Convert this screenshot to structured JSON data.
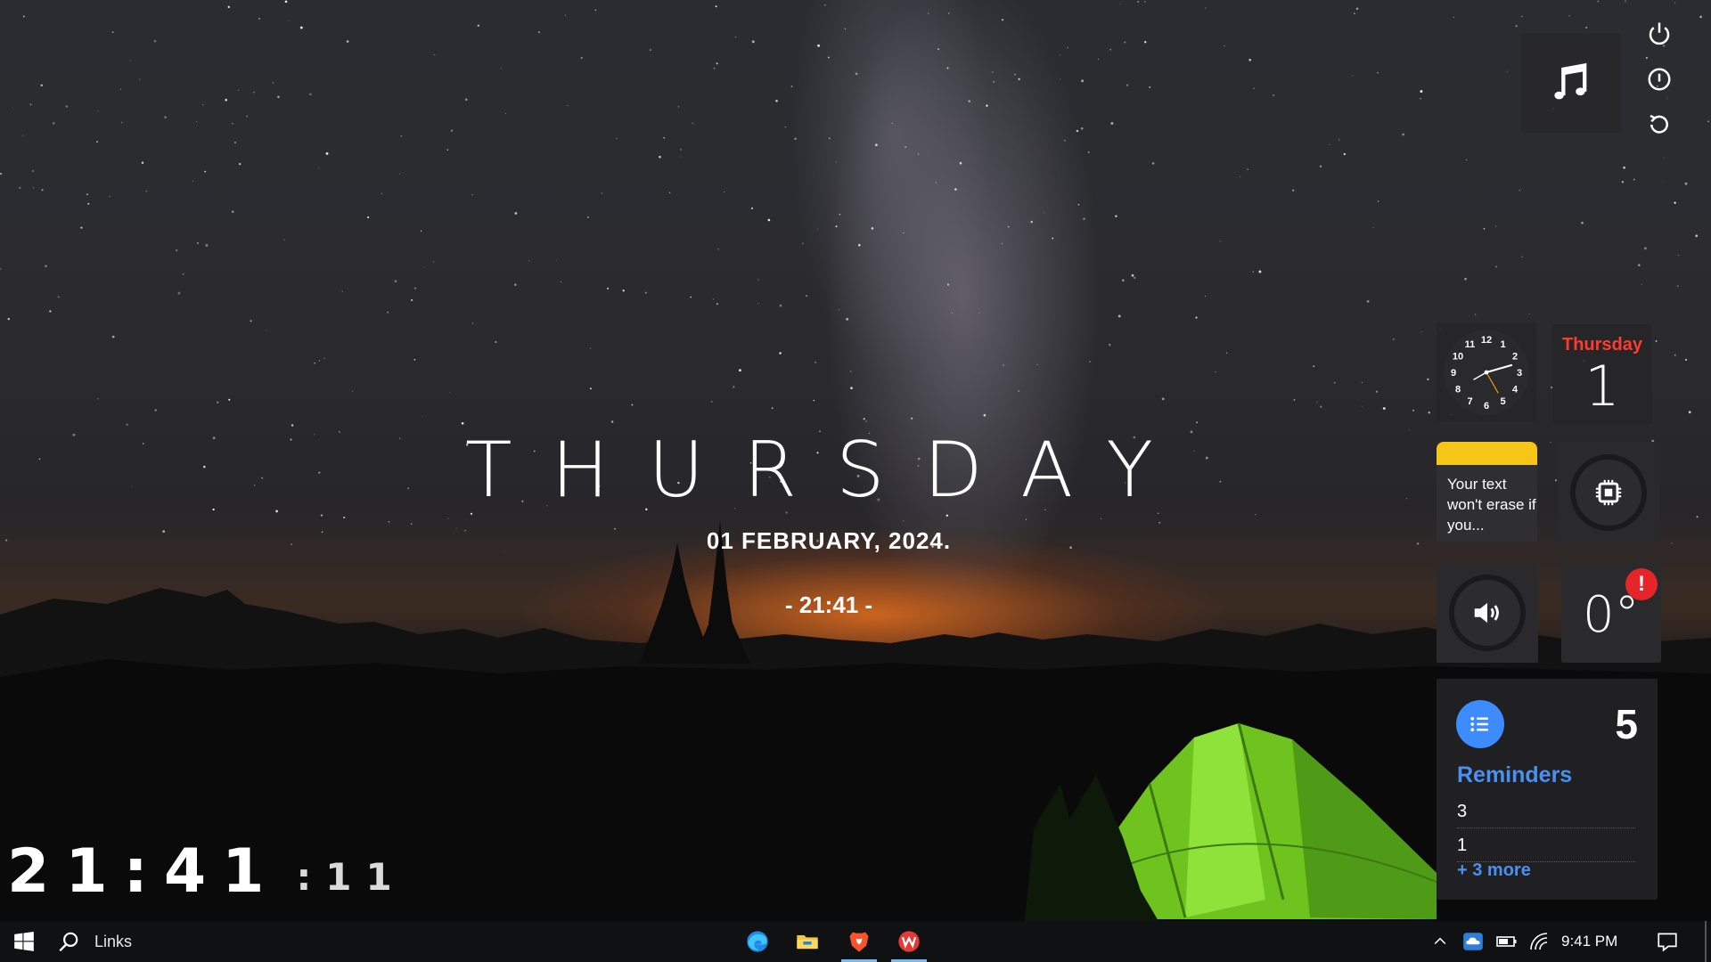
{
  "desktop": {
    "day_name": "THURSDAY",
    "date_text": "01 FEBRUARY, 2024.",
    "time_text": "- 21:41 -",
    "digital_clock": {
      "hm": "21:41",
      "seconds": ":11"
    }
  },
  "widgets": {
    "music": {
      "icon": "music-note-icon"
    },
    "power_buttons": [
      {
        "name": "power-icon"
      },
      {
        "name": "info-icon"
      },
      {
        "name": "restart-icon"
      }
    ],
    "analog_clock": {
      "numbers": [
        "12",
        "1",
        "2",
        "3",
        "4",
        "5",
        "6",
        "7",
        "8",
        "9",
        "10",
        "11"
      ]
    },
    "calendar": {
      "day": "Thursday",
      "date": "1"
    },
    "sticky_note": {
      "text": "Your text won't erase if you..."
    },
    "cpu": {
      "icon": "cpu-chip-icon"
    },
    "volume": {
      "icon": "speaker-icon"
    },
    "weather": {
      "temperature": "0°",
      "alert": "!"
    },
    "reminders": {
      "count": "5",
      "title": "Reminders",
      "items": [
        "3",
        "1"
      ],
      "more": "+ 3 more"
    }
  },
  "taskbar": {
    "search_label": "Links",
    "apps": [
      {
        "name": "edge-icon"
      },
      {
        "name": "file-explorer-icon"
      },
      {
        "name": "brave-icon"
      },
      {
        "name": "wps-office-icon"
      }
    ],
    "clock": "9:41 PM"
  },
  "colors": {
    "accent_blue": "#3d8bfd",
    "calendar_red": "#ff3b30",
    "note_yellow": "#f5c518",
    "alert_red": "#e5252a",
    "tent_green": "#7fd02a"
  }
}
